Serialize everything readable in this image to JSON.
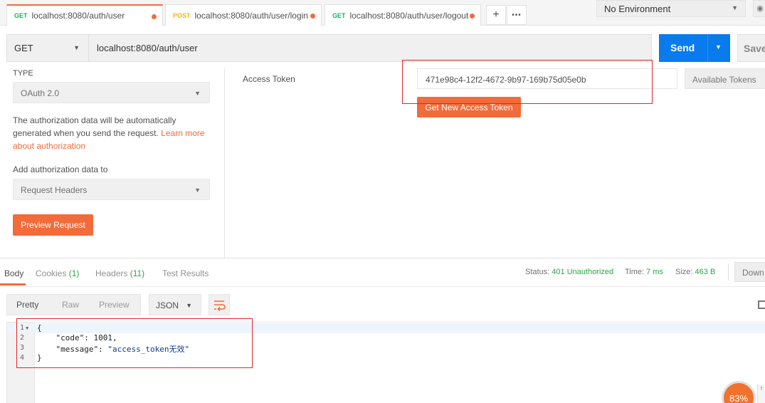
{
  "tabs": [
    {
      "method": "GET",
      "url": "localhost:8080/auth/user"
    },
    {
      "method": "POST",
      "url": "localhost:8080/auth/user/login"
    },
    {
      "method": "GET",
      "url": "localhost:8080/auth/user/logout"
    }
  ],
  "tab_actions": {
    "add": "+",
    "more": "•••"
  },
  "environment": {
    "selected": "No Environment"
  },
  "request": {
    "method": "GET",
    "url": "localhost:8080/auth/user",
    "send_label": "Send",
    "save_label": "Save"
  },
  "auth": {
    "type_label": "TYPE",
    "type_value": "OAuth 2.0",
    "description": "The authorization data will be automatically generated when you send the request.",
    "learn_link": "Learn more about authorization",
    "add_to_label": "Add authorization data to",
    "add_to_value": "Request Headers",
    "preview_label": "Preview Request",
    "access_token_label": "Access Token",
    "access_token_value": "471e98c4-12f2-4672-9b97-169b75d05e0b",
    "available_tokens_label": "Available Tokens",
    "get_new_token_label": "Get New Access Token"
  },
  "response": {
    "tabs": {
      "body": "Body",
      "cookies": "Cookies",
      "cookies_count": "(1)",
      "headers": "Headers",
      "headers_count": "(11)",
      "tests": "Test Results"
    },
    "status_label": "Status:",
    "status_value": "401 Unauthorized",
    "time_label": "Time:",
    "time_value": "7 ms",
    "size_label": "Size:",
    "size_value": "463 B",
    "download_label": "Down",
    "formats": {
      "pretty": "Pretty",
      "raw": "Raw",
      "preview": "Preview"
    },
    "language": "JSON",
    "line_numbers": [
      "1",
      "2",
      "3",
      "4"
    ],
    "code": {
      "open": "{",
      "k1": "\"code\"",
      "v1": "1001",
      "k2": "\"message\"",
      "v2": "\"access_token无效\"",
      "close": "}"
    }
  },
  "overlay": {
    "percent": "83%"
  },
  "colors": {
    "accent": "#f26b3a",
    "send": "#097bed",
    "success": "#28a745",
    "highlight": "#e0282a"
  }
}
